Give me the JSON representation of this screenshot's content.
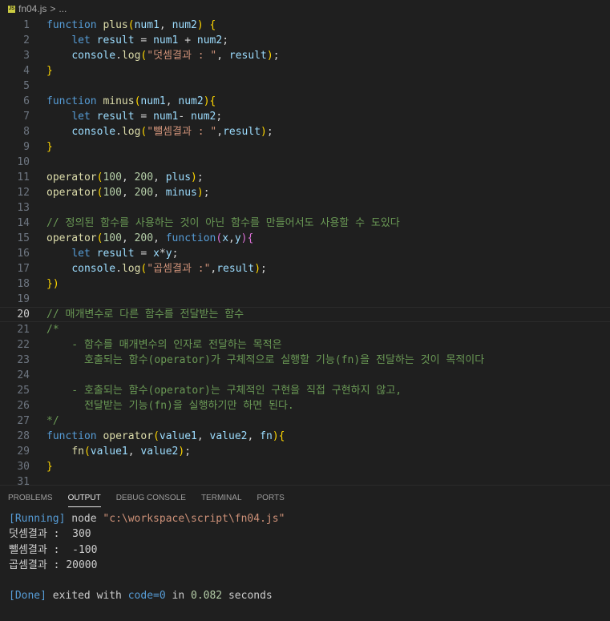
{
  "breadcrumb": {
    "file": "fn04.js",
    "sep": ">",
    "more": "...",
    "icon": "js-file-icon"
  },
  "editor": {
    "current_line": 20,
    "line_numbers": [
      "1",
      "2",
      "3",
      "4",
      "5",
      "6",
      "7",
      "8",
      "9",
      "10",
      "11",
      "12",
      "13",
      "14",
      "15",
      "16",
      "17",
      "18",
      "19",
      "20",
      "21",
      "22",
      "23",
      "24",
      "25",
      "26",
      "27",
      "28",
      "29",
      "30",
      "31"
    ],
    "lines": [
      "function plus(num1, num2) {",
      "    let result = num1 + num2;",
      "    console.log(\"덧셈결과 : \", result);",
      "}",
      "",
      "function minus(num1, num2){",
      "    let result = num1- num2;",
      "    console.log(\"뺄셈결과 : \",result);",
      "}",
      "",
      "operator(100, 200, plus);",
      "operator(100, 200, minus);",
      "",
      "// 정의된 함수를 사용하는 것이 아닌 함수를 만들어서도 사용할 수 도있다",
      "operator(100, 200, function(x,y){",
      "    let result = x*y;",
      "    console.log(\"곱셈결과 :\",result);",
      "})",
      "",
      "// 매개변수로 다른 함수를 전달받는 함수",
      "/*",
      "    - 함수를 매개변수의 인자로 전달하는 목적은",
      "      호출되는 함수(operator)가 구체적으로 실행할 기능(fn)을 전달하는 것이 목적이다",
      "",
      "    - 호출되는 함수(operator)는 구체적인 구현을 직접 구현하지 않고,",
      "      전달받는 기능(fn)을 실행하기만 하면 된다.",
      "*/",
      "function operator(value1, value2, fn){",
      "    fn(value1, value2);",
      "}",
      ""
    ]
  },
  "panel": {
    "tabs": [
      "PROBLEMS",
      "OUTPUT",
      "DEBUG CONSOLE",
      "TERMINAL",
      "PORTS"
    ],
    "active_tab": "OUTPUT",
    "output": {
      "running_tag": "[Running]",
      "running_cmd": " node ",
      "running_path": "\"c:\\workspace\\script\\fn04.js\"",
      "results": [
        "덧셈결과 :  300",
        "뺄셈결과 :  -100",
        "곱셈결과 : 20000"
      ],
      "done_tag": "[Done]",
      "done_text_1": " exited with ",
      "done_code": "code=0",
      "done_text_2": " in ",
      "done_time": "0.082",
      "done_text_3": " seconds"
    }
  },
  "colors": {
    "background": "#1f1f1f",
    "keyword": "#569cd6",
    "function": "#dcdcaa",
    "string": "#ce9178",
    "comment": "#6a9955"
  }
}
